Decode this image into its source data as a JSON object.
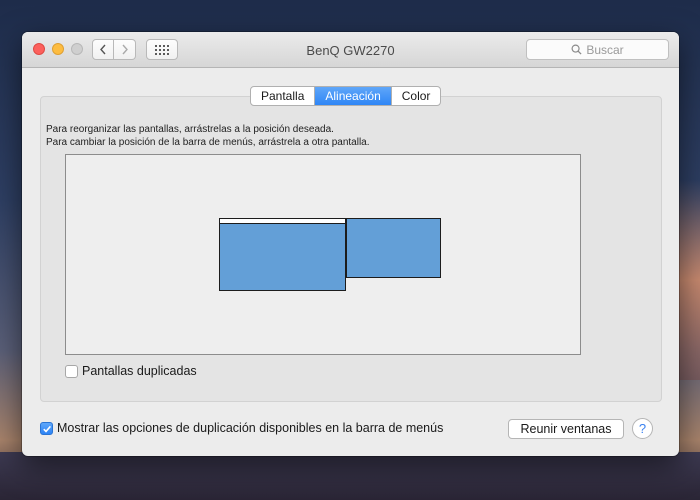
{
  "window": {
    "title": "BenQ GW2270",
    "search_placeholder": "Buscar"
  },
  "icons": {
    "back": "chevron-left-icon",
    "forward": "chevron-right-icon",
    "show_all": "grid-icon",
    "search": "search-icon"
  },
  "tabs": [
    {
      "label": "Pantalla",
      "active": false
    },
    {
      "label": "Alineación",
      "active": true
    },
    {
      "label": "Color",
      "active": false
    }
  ],
  "arrangement": {
    "instruction_line1": "Para reorganizar las pantallas, arrástrelas a la posición deseada.",
    "instruction_line2": "Para cambiar la posición de la barra de menús, arrástrela a otra pantalla.",
    "display_color": "#639fd7"
  },
  "mirror_displays": {
    "label": "Pantallas duplicadas",
    "checked": false
  },
  "show_mirroring_options": {
    "label": "Mostrar las opciones de duplicación disponibles en la barra de menús",
    "checked": true
  },
  "gather_windows_label": "Reunir ventanas",
  "help_label": "?"
}
